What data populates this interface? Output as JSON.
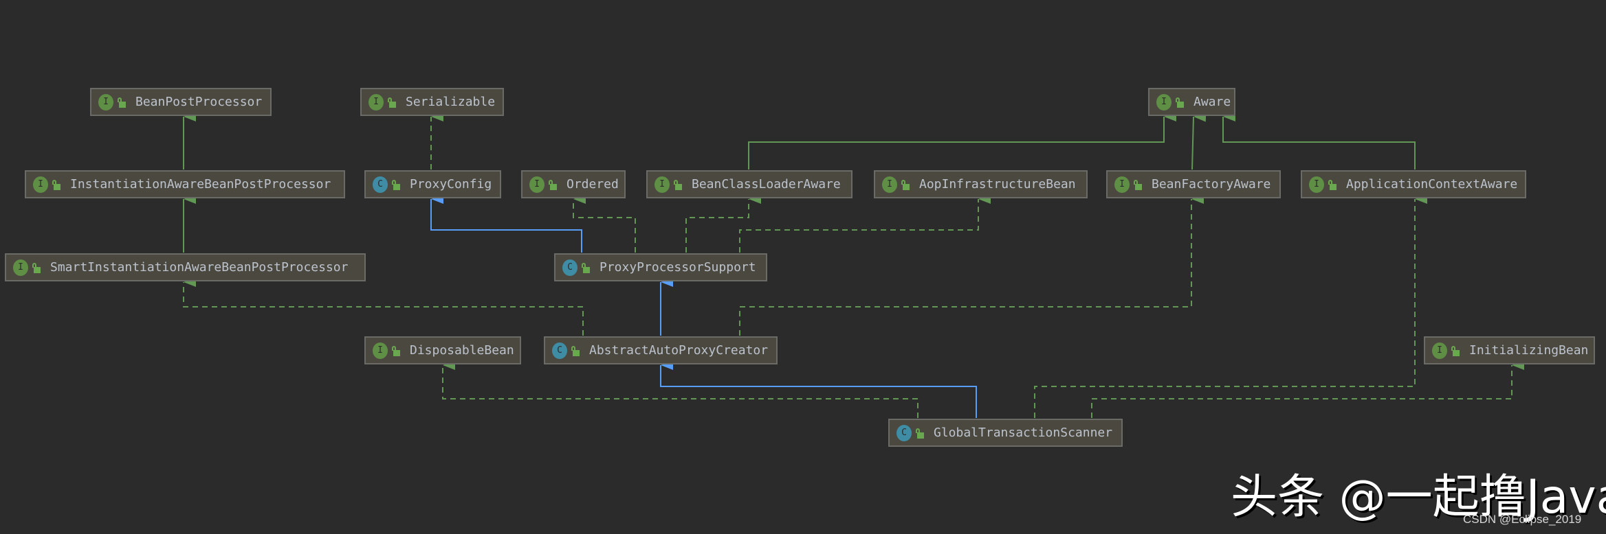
{
  "colors": {
    "background": "#2b2b2b",
    "node_fill": "#4b4840",
    "interface_icon": "#5f8f45",
    "class_icon": "#3f8da4",
    "implements_edge": "#629755",
    "extends_edge": "#589df6"
  },
  "nodes": {
    "bean_post_processor": {
      "label": "BeanPostProcessor",
      "kind": "I"
    },
    "serializable": {
      "label": "Serializable",
      "kind": "I"
    },
    "aware": {
      "label": "Aware",
      "kind": "I"
    },
    "instantiation_aware_bpp": {
      "label": "InstantiationAwareBeanPostProcessor",
      "kind": "I"
    },
    "proxy_config": {
      "label": "ProxyConfig",
      "kind": "C"
    },
    "ordered": {
      "label": "Ordered",
      "kind": "I"
    },
    "bean_class_loader_aware": {
      "label": "BeanClassLoaderAware",
      "kind": "I"
    },
    "aop_infrastructure_bean": {
      "label": "AopInfrastructureBean",
      "kind": "I"
    },
    "bean_factory_aware": {
      "label": "BeanFactoryAware",
      "kind": "I"
    },
    "application_context_aware": {
      "label": "ApplicationContextAware",
      "kind": "I"
    },
    "smart_instantiation_aware_bpp": {
      "label": "SmartInstantiationAwareBeanPostProcessor",
      "kind": "I"
    },
    "proxy_processor_support": {
      "label": "ProxyProcessorSupport",
      "kind": "C"
    },
    "disposable_bean": {
      "label": "DisposableBean",
      "kind": "I"
    },
    "abstract_auto_proxy_creator": {
      "label": "AbstractAutoProxyCreator",
      "kind": "C"
    },
    "initializing_bean": {
      "label": "InitializingBean",
      "kind": "I"
    },
    "global_transaction_scanner": {
      "label": "GlobalTransactionScanner",
      "kind": "C"
    }
  },
  "watermark": {
    "text": "头条 @一起撸Java",
    "credit": "CSDN @Eclipse_2019"
  }
}
